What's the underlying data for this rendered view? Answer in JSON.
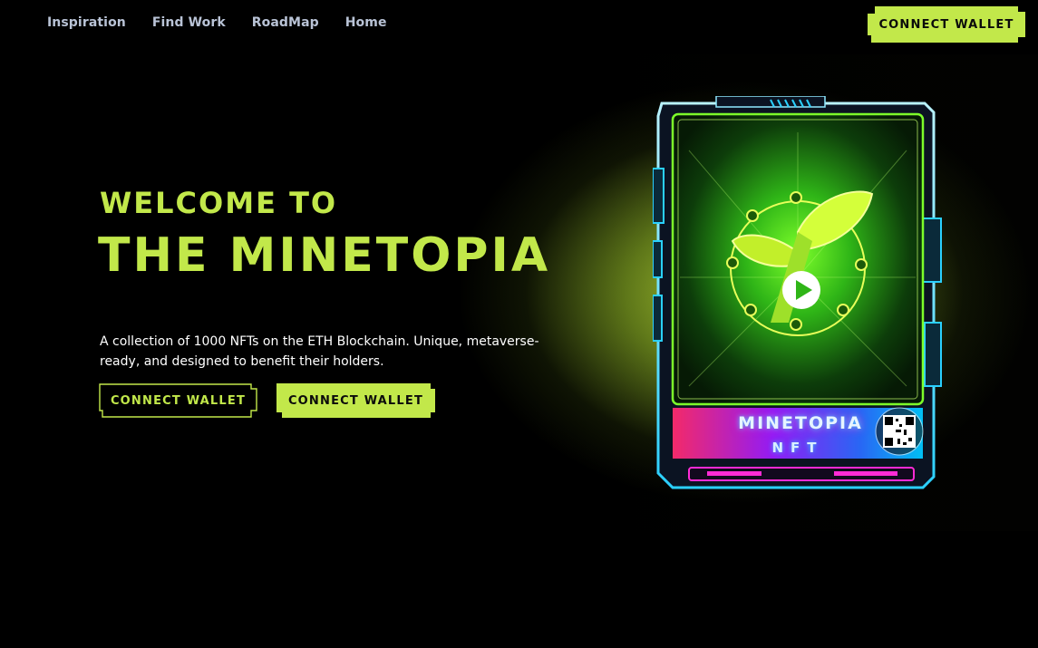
{
  "nav": {
    "links": [
      "Inspiration",
      "Find Work",
      "RoadMap",
      "Home"
    ],
    "cta_label": "CONNECT WALLET"
  },
  "hero": {
    "headline_line1": "WELCOME TO",
    "headline_line2": "THE MINETOPIA",
    "description": "A collection of 1000 NFTs on the ETH Blockchain. Unique, metaverse-ready, and designed to benefit their holders.",
    "primary_button": "CONNECT WALLET",
    "secondary_button": "CONNECT WALLET"
  },
  "card": {
    "title": "MINETOPIA",
    "subtitle": "NFT",
    "play_icon": "play-icon",
    "emblem_icon": "leaf-emblem-icon",
    "qr_icon": "qr-code-icon"
  },
  "colors": {
    "background": "#000000",
    "accent": "#c2e84a",
    "nav_text": "#b9c3d6",
    "neon_cyan": "#2ad0ff",
    "neon_magenta": "#ff2bd6",
    "neon_green": "#39ff14"
  }
}
